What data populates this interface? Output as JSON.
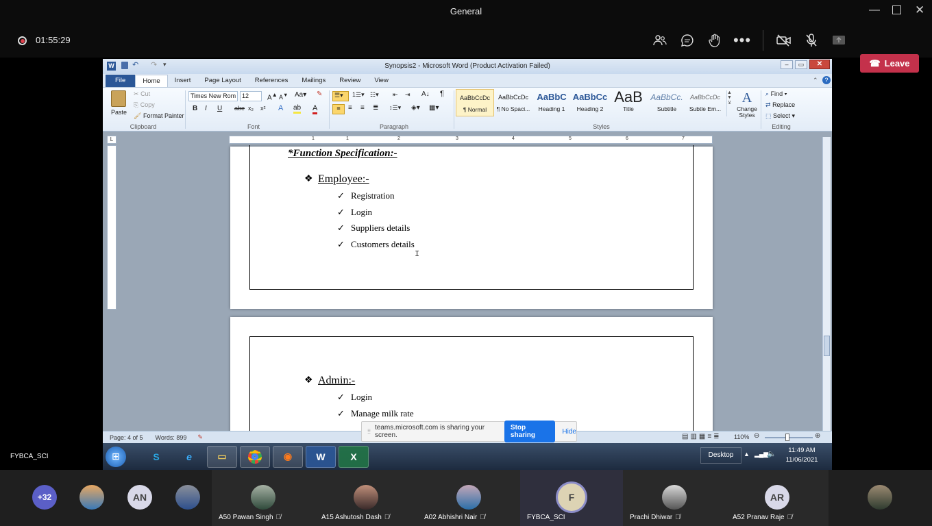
{
  "teams": {
    "window_title": "General",
    "timer": "01:55:29",
    "leave_label": "Leave",
    "accent": "#c4314b"
  },
  "word": {
    "title": "Synopsis2  -  Microsoft Word (Product Activation Failed)",
    "tabs": [
      "File",
      "Home",
      "Insert",
      "Page Layout",
      "References",
      "Mailings",
      "Review",
      "View"
    ],
    "active_tab": "Home",
    "clipboard": {
      "paste": "Paste",
      "cut": "Cut",
      "copy": "Copy",
      "format_painter": "Format Painter",
      "label": "Clipboard"
    },
    "font": {
      "name": "Times New Rom",
      "size": "12",
      "label": "Font"
    },
    "paragraph_label": "Paragraph",
    "styles": {
      "label": "Styles",
      "items": [
        {
          "preview": "AaBbCcDc",
          "name": "¶ Normal"
        },
        {
          "preview": "AaBbCcDc",
          "name": "¶ No Spaci..."
        },
        {
          "preview": "AaBbC",
          "name": "Heading 1"
        },
        {
          "preview": "AaBbCc",
          "name": "Heading 2"
        },
        {
          "preview": "AaB",
          "name": "Title"
        },
        {
          "preview": "AaBbCc.",
          "name": "Subtitle"
        },
        {
          "preview": "AaBbCcDc",
          "name": "Subtle Em..."
        }
      ],
      "change_styles": "Change Styles"
    },
    "editing": {
      "find": "Find",
      "replace": "Replace",
      "select": "Select",
      "label": "Editing"
    },
    "ruler_numbers": [
      "1",
      "1",
      "2",
      "3",
      "4",
      "5",
      "6",
      "7"
    ],
    "document": {
      "heading": "*Function Specification:-",
      "section1_title": "Employee:-",
      "section1_items": [
        "Registration",
        "Login",
        "Suppliers details",
        "Customers details"
      ],
      "section2_title": "Admin:-",
      "section2_items": [
        "Login",
        "Manage milk rate"
      ]
    },
    "status": {
      "page": "Page: 4 of 5",
      "words": "Words: 899",
      "zoom": "110%"
    }
  },
  "share_banner": {
    "text": "teams.microsoft.com is sharing your screen.",
    "stop": "Stop sharing",
    "hide": "Hide"
  },
  "taskbar": {
    "desktop_label": "Desktop",
    "time": "11:49 AM",
    "date": "11/06/2021",
    "apps": [
      "skype",
      "ie",
      "explorer",
      "chrome",
      "firefox",
      "word",
      "excel"
    ]
  },
  "meeting_label": "FYBCA_SCI",
  "participants": {
    "overflow": "+32",
    "small": [
      {
        "initials": "",
        "icon": "photo"
      },
      {
        "initials": "AN"
      },
      {
        "initials": "",
        "icon": "photo"
      }
    ],
    "tiles": [
      {
        "name": "A50 Pawan Singh",
        "initials": ""
      },
      {
        "name": "A15 Ashutosh Dash",
        "initials": ""
      },
      {
        "name": "A02 Abhishri Nair",
        "initials": ""
      },
      {
        "name": "FYBCA_SCI",
        "initials": "F"
      },
      {
        "name": "Prachi Dhiwar",
        "initials": ""
      },
      {
        "name": "A52 Pranav Raje",
        "initials": "AR"
      }
    ]
  }
}
